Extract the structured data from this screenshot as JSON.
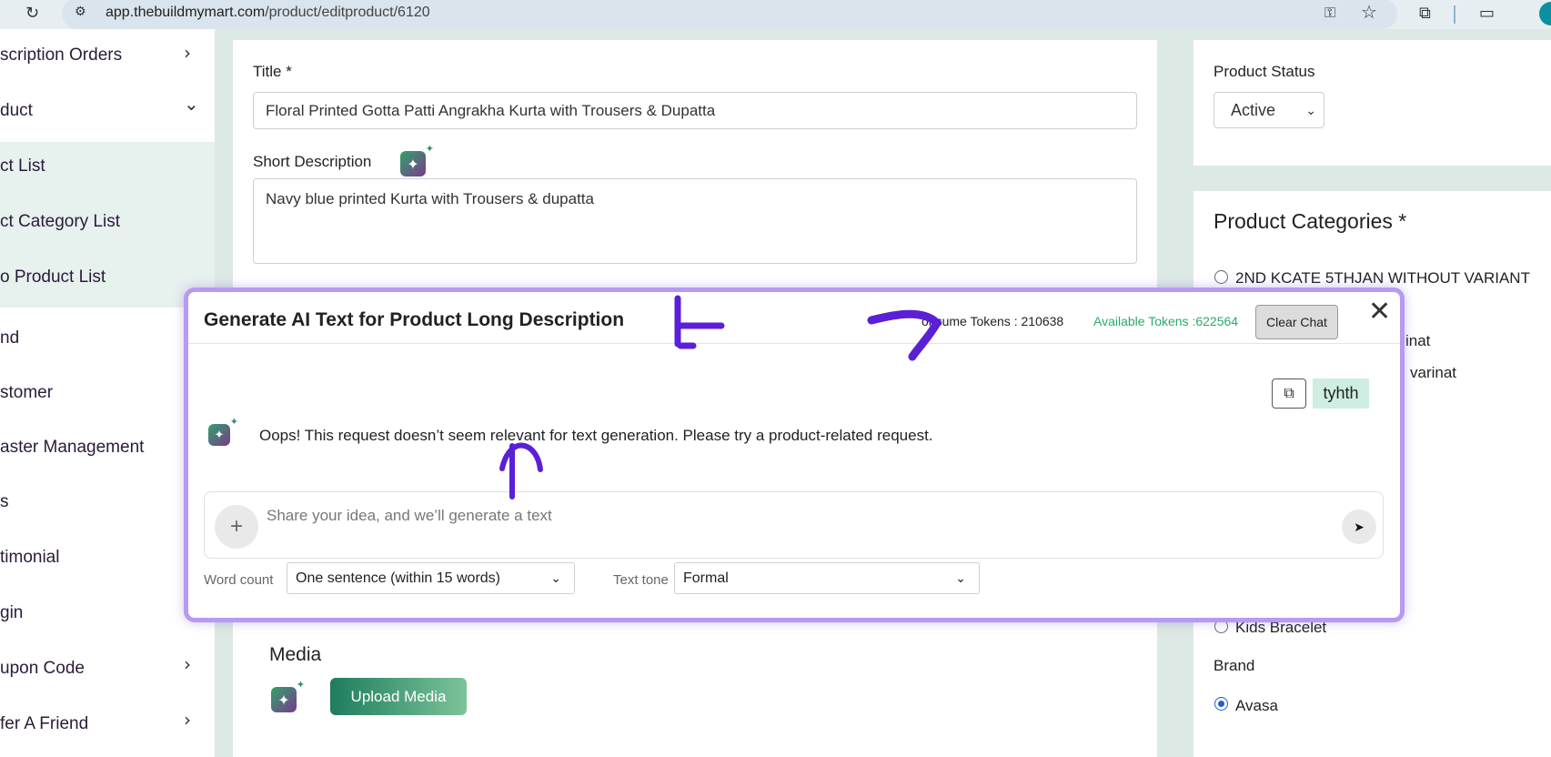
{
  "browser": {
    "url_host": "app.thebuildmymart.com",
    "url_path": "/product/editproduct/6120",
    "icons": [
      "reload-icon",
      "site-info-icon",
      "key-icon",
      "star-icon",
      "extensions-icon",
      "cast-icon"
    ]
  },
  "sidebar": {
    "items": [
      {
        "label": "scription Orders",
        "chevron": "›"
      },
      {
        "label": "duct",
        "chevron": "⌄"
      },
      {
        "label": "ct List"
      },
      {
        "label": "ct Category List"
      },
      {
        "label": "o Product List"
      },
      {
        "label": "nd"
      },
      {
        "label": "stomer"
      },
      {
        "label": "aster Management"
      },
      {
        "label": "s"
      },
      {
        "label": "timonial"
      },
      {
        "label": "gin"
      },
      {
        "label": "upon Code",
        "chevron": "›"
      },
      {
        "label": "fer A Friend",
        "chevron": "›"
      }
    ]
  },
  "form": {
    "title_label": "Title *",
    "title_value": "Floral Printed Gotta Patti Angrakha Kurta with Trousers & Dupatta",
    "short_desc_label": "Short Description",
    "short_desc_value": "Navy blue printed Kurta with Trousers & dupatta",
    "media_title": "Media",
    "upload_label": "Upload Media"
  },
  "right": {
    "status_label": "Product Status",
    "status_value": "Active",
    "categories_title": "Product Categories *",
    "categories": [
      {
        "label": "2ND KCATE 5THJAN WITHOUT VARIANT",
        "checked": false
      },
      {
        "label": "inat"
      },
      {
        "label": "varinat"
      },
      {
        "label": "Kids Bracelet",
        "checked": false
      }
    ],
    "brand_label": "Brand",
    "brand_value": "Avasa"
  },
  "modal": {
    "title": "Generate AI Text for Product Long Description",
    "consume_tokens": "onsume Tokens : 210638",
    "available_tokens": "Available Tokens :622564",
    "clear_label": "Clear Chat",
    "close_glyph": "✕",
    "user_chip": "tyhth",
    "bot_message": "Oops! This request doesn’t seem relevant for text generation. Please try a product-related request.",
    "prompt_placeholder": "Share your idea, and we’ll generate a text",
    "word_count_label": "Word count",
    "word_count_value": "One sentence (within 15 words)",
    "text_tone_label": "Text tone",
    "text_tone_value": "Formal"
  },
  "colors": {
    "accent_purple": "#b69af3",
    "token_green": "#2aaa6a",
    "annotation": "#5b1fd6"
  }
}
